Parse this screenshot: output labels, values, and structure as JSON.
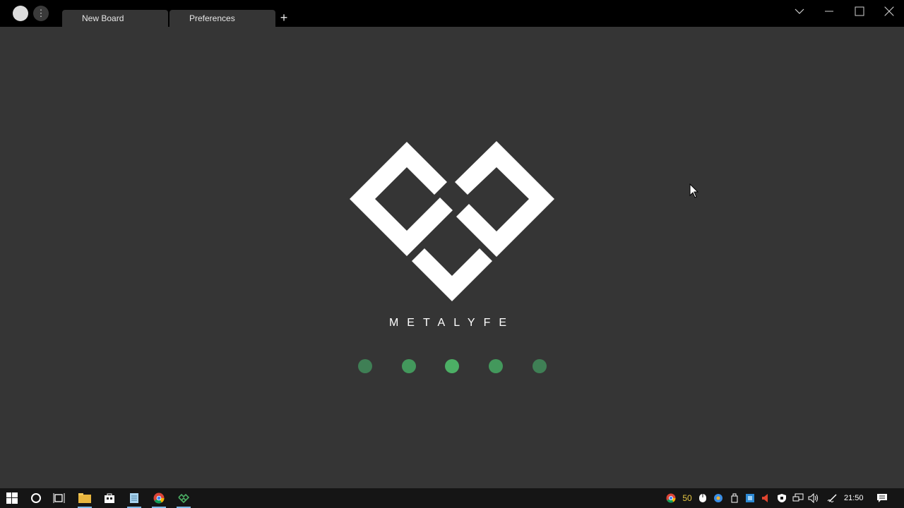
{
  "window": {
    "tabs": [
      {
        "label": "New Board"
      },
      {
        "label": "Preferences"
      }
    ],
    "new_tab_label": "+",
    "menu_label": "⋮"
  },
  "splash": {
    "brand_name": "METALYFE",
    "logo_color": "#ffffff",
    "loading_dot_colors": [
      "#3f7f55",
      "#43985c",
      "#4caf65",
      "#43985c",
      "#3f7f55"
    ]
  },
  "taskbar": {
    "pinned_apps": [
      "windows-start-icon",
      "cortana-icon",
      "task-view-icon",
      "file-explorer-icon",
      "store-icon",
      "notepad-icon",
      "chrome-icon",
      "metalyfe-app-icon"
    ],
    "tray_badge": "50",
    "clock": "21:50"
  }
}
